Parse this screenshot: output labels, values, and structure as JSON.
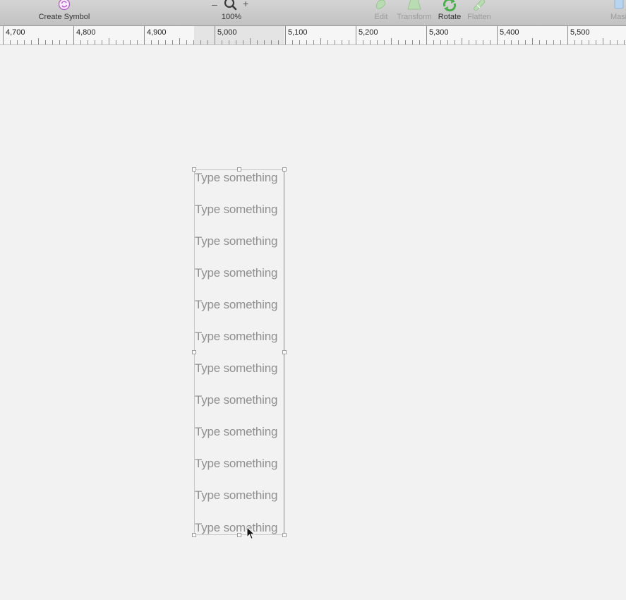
{
  "toolbar": {
    "create_symbol": "Create Symbol",
    "zoom_minus": "–",
    "zoom_plus": "+",
    "zoom_level": "100%",
    "edit": "Edit",
    "transform": "Transform",
    "rotate": "Rotate",
    "flatten": "Flatten",
    "mask": "Mask"
  },
  "ruler": {
    "labels": [
      "4,700",
      "4,800",
      "4,900",
      "5,000",
      "5,100",
      "5,200",
      "5,300",
      "5,400",
      "5,500"
    ]
  },
  "textbox": {
    "lines": [
      "Type something",
      "Type something",
      "Type something",
      "Type something",
      "Type something",
      "Type something",
      "Type something",
      "Type something",
      "Type something",
      "Type something",
      "Type something",
      "Type something"
    ]
  },
  "colors": {
    "accent_purple": "#b05fc8",
    "icon_green": "#4cae4c",
    "placeholder_text": "#8f8f8f"
  }
}
